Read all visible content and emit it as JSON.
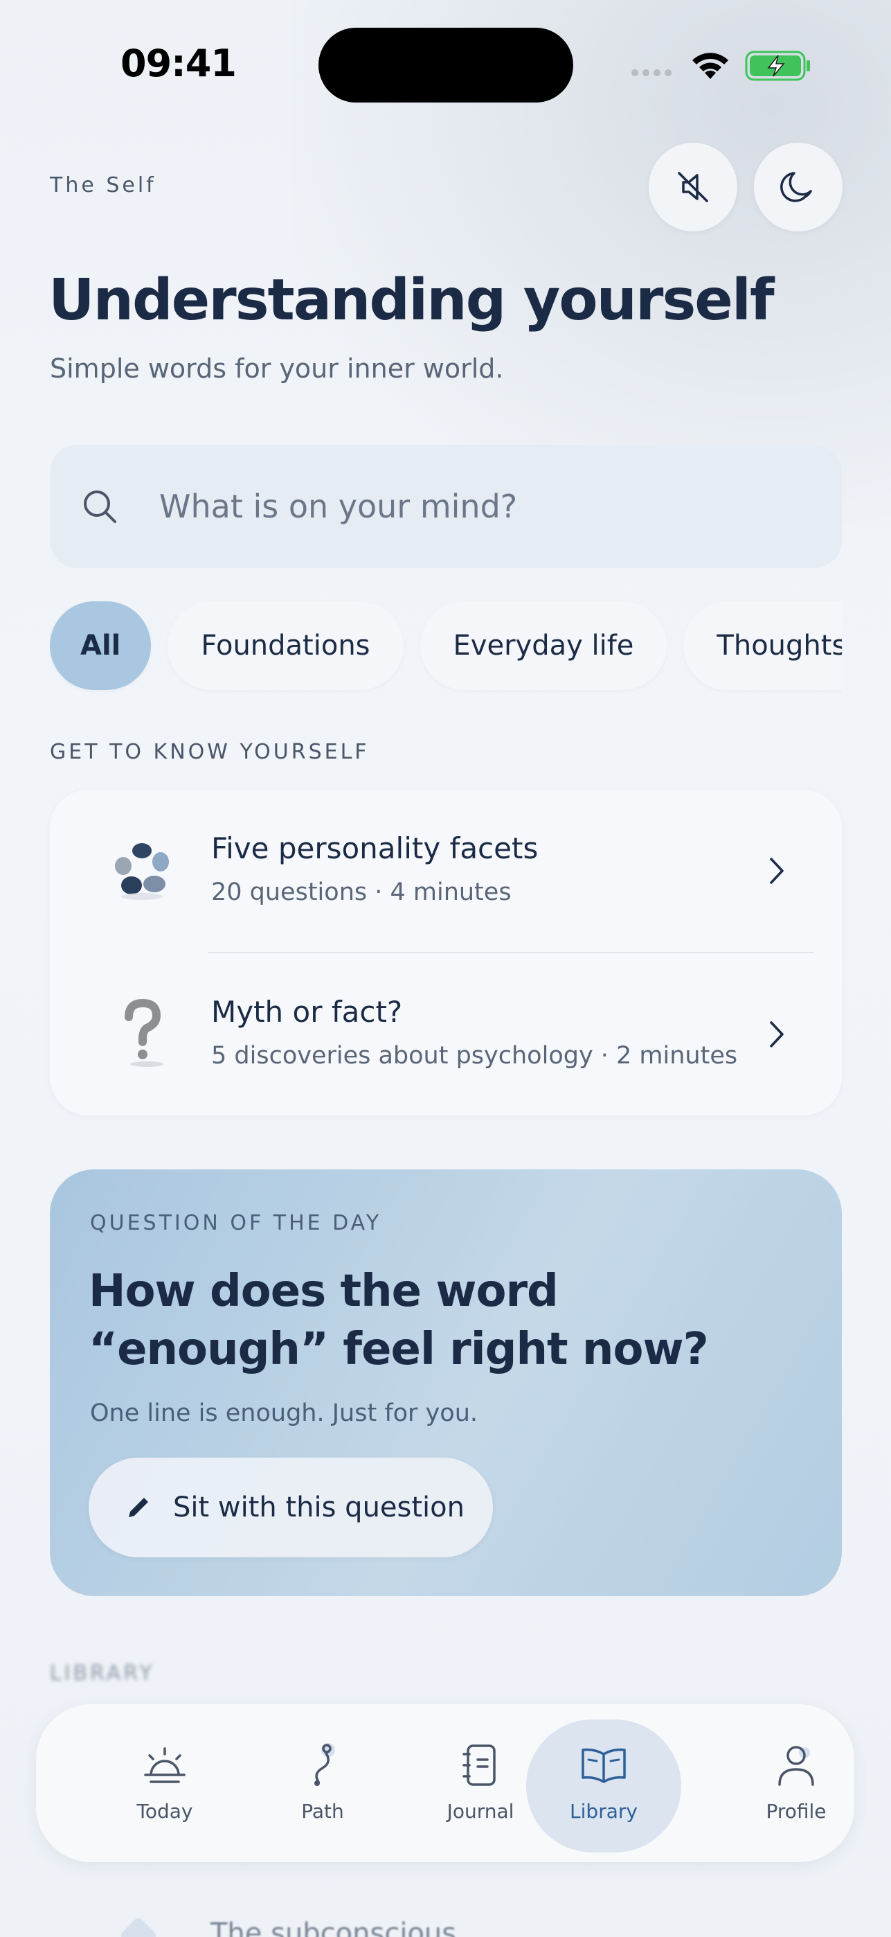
{
  "status_bar": {
    "time": "09:41"
  },
  "header": {
    "eyebrow": "The Self",
    "title": "Understanding yourself",
    "subtitle": "Simple words for your inner world.",
    "mute_icon": "speaker-muted-icon",
    "theme_icon": "moon-icon"
  },
  "search": {
    "placeholder": "What is on your mind?"
  },
  "chips": [
    "All",
    "Foundations",
    "Everyday life",
    "Thoughts"
  ],
  "active_chip": "All",
  "know_yourself": {
    "label": "GET TO KNOW YOURSELF",
    "items": [
      {
        "title": "Five personality facets",
        "meta": "20 questions · 4 minutes",
        "icon": "stones-icon"
      },
      {
        "title": "Myth or fact?",
        "meta": "5 discoveries about psychology · 2 minutes",
        "icon": "question-mark-icon"
      }
    ]
  },
  "question_of_day": {
    "label": "QUESTION OF THE DAY",
    "question": "How does the word “enough” feel right now?",
    "hint": "One line is enough. Just for you.",
    "button": "Sit with this question"
  },
  "library": {
    "label": "LIBRARY",
    "peek_title": "The subconscious"
  },
  "tabbar": {
    "items": [
      {
        "label": "Today",
        "icon": "sunrise-icon"
      },
      {
        "label": "Path",
        "icon": "path-icon"
      },
      {
        "label": "Journal",
        "icon": "notebook-icon"
      },
      {
        "label": "Library",
        "icon": "open-book-icon"
      },
      {
        "label": "Profile",
        "icon": "person-icon"
      }
    ],
    "active": "Library"
  },
  "colors": {
    "accent": "#2e5f99",
    "chip_active": "#a9c7e0",
    "text": "#1c2b45",
    "battery": "#3fc35a"
  }
}
